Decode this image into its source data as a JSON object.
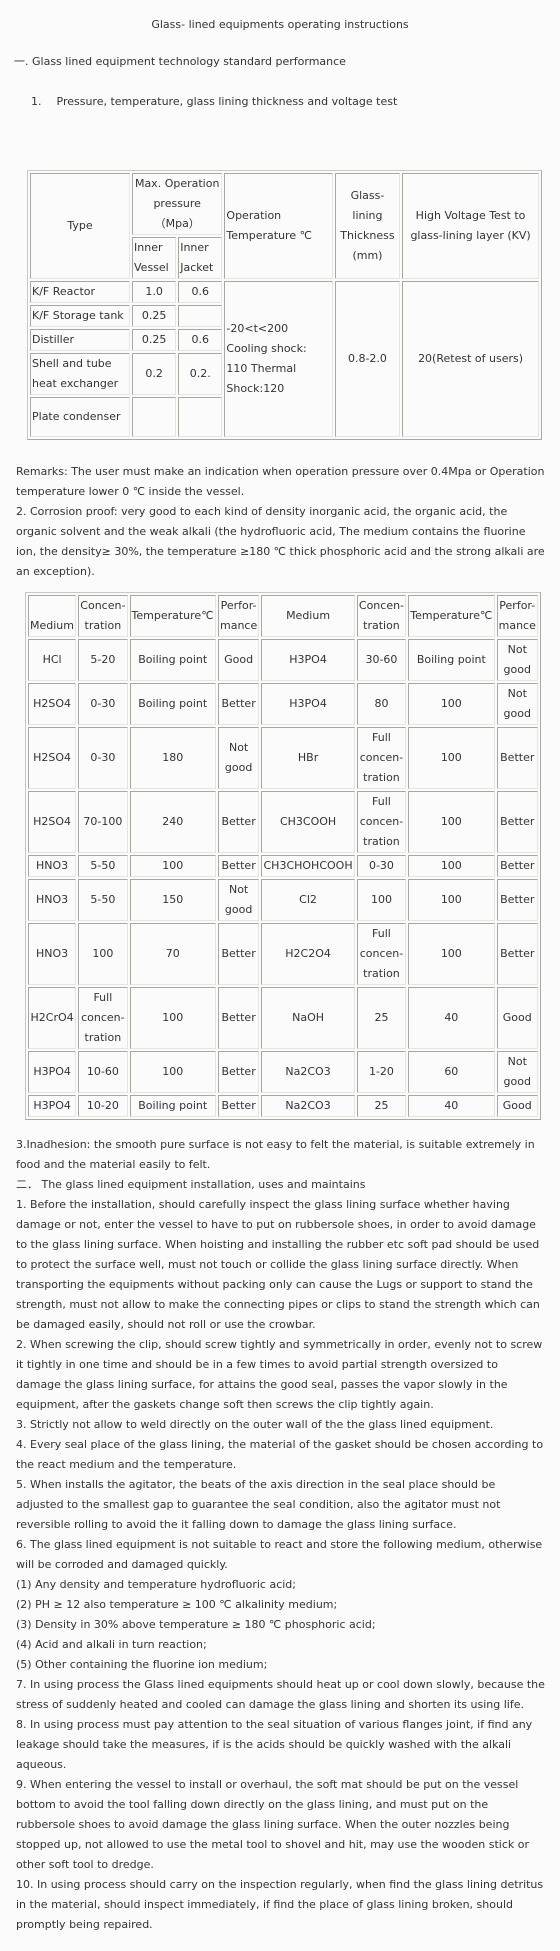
{
  "title": "Glass- lined equipments operating instructions",
  "section1": {
    "heading": "一. Glass lined equipment technology standard performance",
    "sub_number": "1.",
    "sub_heading": "Pressure, temperature, glass lining thickness and voltage test"
  },
  "table1": {
    "headers": {
      "type": "Type",
      "max_pressure": "Max. Operation pressure （Mpa）",
      "inner_vessel": "Inner Vessel",
      "inner_jacket": "Inner Jacket",
      "temperature": "Operation Temperature ℃",
      "thickness": "Glass-lining Thickness (mm)",
      "voltage": "High Voltage Test to glass-lining layer (KV)"
    },
    "rows": [
      {
        "type": "K/F Reactor",
        "vessel": "1.0",
        "jacket": "0.6"
      },
      {
        "type": "K/F Storage tank",
        "vessel": "0.25",
        "jacket": ""
      },
      {
        "type": "Distiller",
        "vessel": "0.25",
        "jacket": "0.6"
      },
      {
        "type": "Shell and tube heat exchanger",
        "vessel": "0.2",
        "jacket": "0.2."
      },
      {
        "type": "Plate condenser",
        "vessel": "",
        "jacket": ""
      }
    ],
    "temperature_value": "-20<t<200 Cooling shock: 110 Thermal Shock:120",
    "thickness_value": "0.8-2.0",
    "voltage_value": "20(Retest of users)"
  },
  "remarks": [
    "Remarks: The user must make an indication when operation pressure over 0.4Mpa or Operation temperature lower 0 ℃ inside the vessel.",
    "2. Corrosion proof: very good to each kind of density inorganic acid, the organic acid, the organic solvent and the weak alkali (the hydrofluoric acid, The medium contains the fluorine ion, the density≥ 30%, the temperature ≥180 ℃ thick phosphoric acid and the strong alkali are an exception)."
  ],
  "table2": {
    "headers": [
      "Medium",
      "Concen-tration",
      "Temperature℃",
      "Perfor-mance",
      "Medium",
      "Concen-tration",
      "Temperature℃",
      "Perfor-mance"
    ],
    "rows": [
      [
        "HCl",
        "5-20",
        "Boiling point",
        "Good",
        "H3PO4",
        "30-60",
        "Boiling point",
        "Not good"
      ],
      [
        "H2SO4",
        "0-30",
        "Boiling point",
        "Better",
        "H3PO4",
        "80",
        "100",
        "Not good"
      ],
      [
        "H2SO4",
        "0-30",
        "180",
        "Not good",
        "HBr",
        "Full concen-tration",
        "100",
        "Better"
      ],
      [
        "H2SO4",
        "70-100",
        "240",
        "Better",
        "CH3COOH",
        "Full concen-tration",
        "100",
        "Better"
      ],
      [
        "HNO3",
        "5-50",
        "100",
        "Better",
        "CH3CHOHCOOH",
        "0-30",
        "100",
        "Better"
      ],
      [
        "HNO3",
        "5-50",
        "150",
        "Not good",
        "Cl2",
        "100",
        "100",
        "Better"
      ],
      [
        "HNO3",
        "100",
        "70",
        "Better",
        "H2C2O4",
        "Full concen-tration",
        "100",
        "Better"
      ],
      [
        "H2CrO4",
        "Full concen-tration",
        "100",
        "Better",
        "NaOH",
        "25",
        "40",
        "Good"
      ],
      [
        "H3PO4",
        "10-60",
        "100",
        "Better",
        "Na2CO3",
        "1-20",
        "60",
        "Not good"
      ],
      [
        "H3PO4",
        "10-20",
        "Boiling point",
        "Better",
        "Na2CO3",
        "25",
        "40",
        "Good"
      ]
    ]
  },
  "part2": [
    "3.Inadhesion: the smooth pure surface is not easy to felt the material, is suitable extremely in food and the material easily to felt.",
    "二．  The glass lined equipment installation, uses and maintains",
    "1. Before the installation, should carefully inspect the glass lining surface whether having damage or not, enter the vessel to have to put on rubbersole shoes, in order to avoid damage to the  glass lining surface. When hoisting and installing the rubber etc soft pad should be used to  protect the surface well, must not touch or  collide the glass lining surface directly. When transporting the equipments without packing only can cause the Lugs or support to stand the strength, must not  allow to make the connecting pipes or clips to stand the strength which can be damaged easily,  should not roll or use the crowbar.",
    "2. When screwing the clip, should screw tightly and symmetrically in order, evenly not to screw it tightly in one time and should be in a few times to avoid partial strength oversized to damage the glass lining surface, for attains the good seal, passes the vapor slowly in the equipment, after the gaskets change soft then screws the clip tightly again.",
    "3. Strictly not allow to weld directly on the outer wall of the the glass lined equipment.",
    "4. Every seal place of the glass lining, the material of the gasket should be chosen according to the react medium and the temperature.",
    "5. When installs the agitator, the beats of the axis direction in the seal place should be  adjusted  to the smallest gap to guarantee the seal condition, also the agitator must not reversible rolling to avoid the it falling down to damage the glass lining surface.",
    "6. The glass lined equipment is not suitable to react and store the following medium, otherwise will be corroded and damaged quickly.",
    "(1) Any density and temperature hydrofluoric acid;",
    "(2) PH ≥ 12 also temperature ≥ 100 ℃ alkalinity medium;",
    "(3) Density in 30% above temperature ≥ 180 ℃ phosphoric acid;",
    "(4) Acid and alkali in turn reaction;",
    "(5) Other containing the fluorine ion medium;",
    "7. In using process the Glass lined equipments should heat up or cool down slowly, because the stress  of  suddenly heated and cooled can damage the glass lining and shorten its using life.",
    "8. In using process must pay attention to the seal situation of various flanges joint, if find any leakage should take the measures, if is the acids should be quickly washed with the alkali aqueous.",
    "9. When entering the vessel to install or overhaul, the soft mat should be put on the vessel bottom to avoid the tool falling down directly on the glass lining, and must put on the rubbersole shoes to avoid damage the glass lining surface. When the outer nozzles being stopped up, not allowed to use the metal tool to shovel and hit, may use the wooden stick or other soft tool to dredge.",
    "10. In using process should carry on the inspection regularly, when find the glass lining detritus in the material, should inspect immediately, if find the place of glass lining broken, should promptly being repaired."
  ]
}
